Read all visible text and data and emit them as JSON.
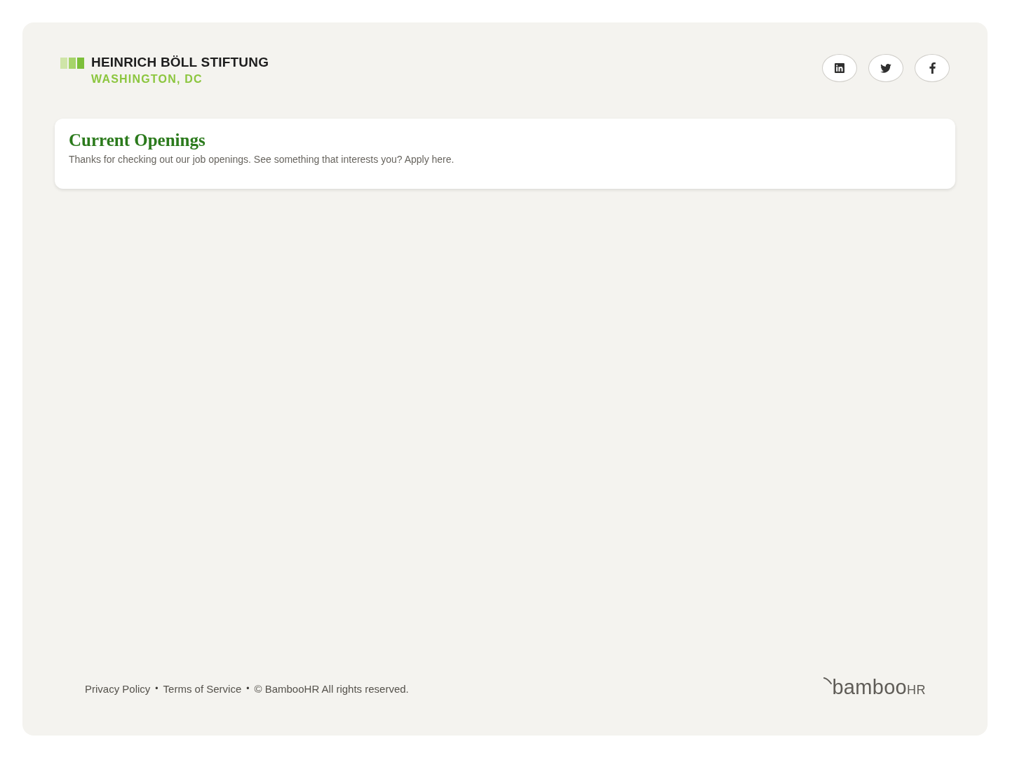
{
  "header": {
    "logo": {
      "name": "HEINRICH BÖLL STIFTUNG",
      "location": "WASHINGTON, DC"
    },
    "social_links": [
      {
        "kind": "linkedin"
      },
      {
        "kind": "twitter"
      },
      {
        "kind": "facebook"
      }
    ]
  },
  "intro_card": {
    "title": "Current Openings",
    "text": "Thanks for checking out our job openings. See something that interests you? Apply here."
  },
  "footer": {
    "items": [
      {
        "kind": "link",
        "text": "Privacy Policy"
      },
      {
        "kind": "separator",
        "text": "•"
      },
      {
        "kind": "link",
        "text": "Terms of Service"
      },
      {
        "kind": "separator",
        "text": "•"
      },
      {
        "kind": "text",
        "text": "© BambooHR All rights reserved."
      }
    ],
    "brand": {
      "word": "bamboo",
      "suffix": "HR"
    }
  }
}
